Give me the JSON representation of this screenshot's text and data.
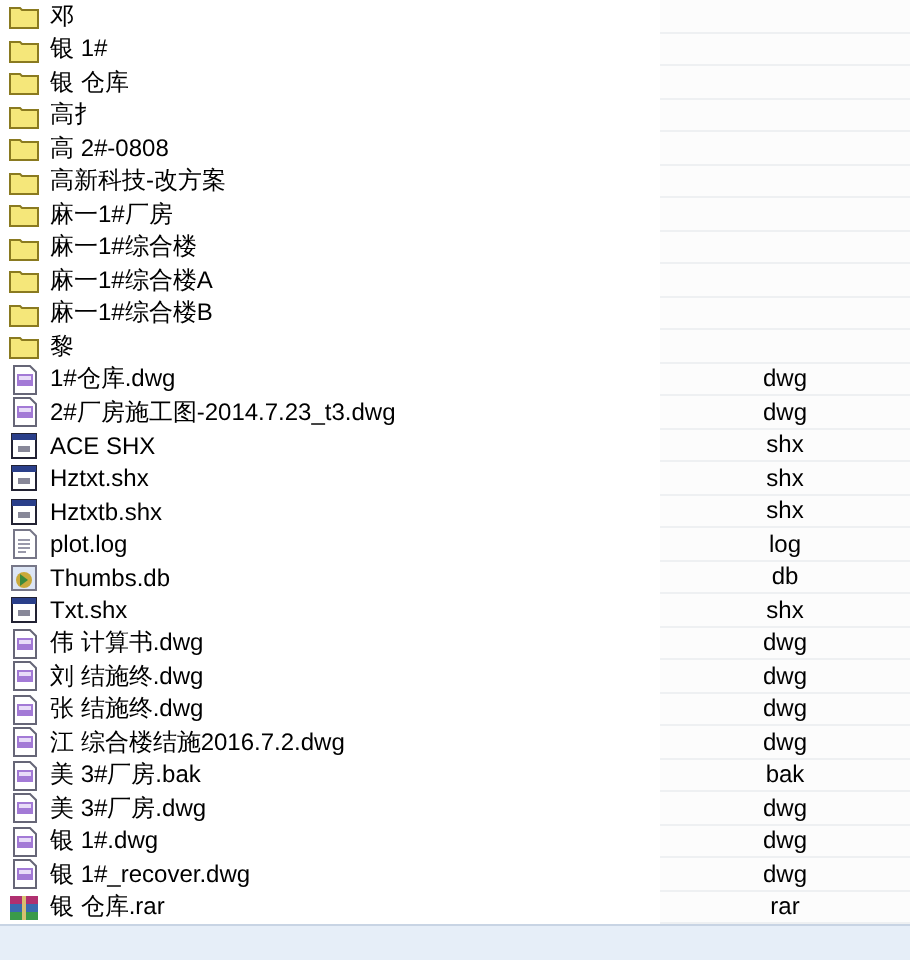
{
  "files": [
    {
      "name": "邓",
      "kind": "folder"
    },
    {
      "name": "银 1#",
      "kind": "folder"
    },
    {
      "name": "银 仓库",
      "kind": "folder"
    },
    {
      "name": "高扌",
      "kind": "folder"
    },
    {
      "name": "高 2#-0808",
      "kind": "folder"
    },
    {
      "name": "高新科技-改方案",
      "kind": "folder"
    },
    {
      "name": "麻一1#厂房",
      "kind": "folder"
    },
    {
      "name": "麻一1#综合楼",
      "kind": "folder"
    },
    {
      "name": "麻一1#综合楼A",
      "kind": "folder"
    },
    {
      "name": "麻一1#综合楼B",
      "kind": "folder"
    },
    {
      "name": "黎",
      "kind": "folder"
    },
    {
      "name": "1#仓库.dwg",
      "kind": "dwg",
      "type": "dwg"
    },
    {
      "name": "2#厂房施工图-2014.7.23_t3.dwg",
      "kind": "dwg",
      "type": "dwg"
    },
    {
      "name": "ACE SHX",
      "kind": "shx",
      "type": "shx"
    },
    {
      "name": "Hztxt.shx",
      "kind": "shx",
      "type": "shx"
    },
    {
      "name": "Hztxtb.shx",
      "kind": "shx",
      "type": "shx"
    },
    {
      "name": "plot.log",
      "kind": "log",
      "type": "log"
    },
    {
      "name": "Thumbs.db",
      "kind": "db",
      "type": "db"
    },
    {
      "name": "Txt.shx",
      "kind": "shx",
      "type": "shx"
    },
    {
      "name": "伟 计算书.dwg",
      "kind": "dwg",
      "type": "dwg"
    },
    {
      "name": "刘 结施终.dwg",
      "kind": "dwg",
      "type": "dwg"
    },
    {
      "name": "张 结施终.dwg",
      "kind": "dwg",
      "type": "dwg"
    },
    {
      "name": "江 综合楼结施2016.7.2.dwg",
      "kind": "dwg",
      "type": "dwg"
    },
    {
      "name": "美 3#厂房.bak",
      "kind": "dwg",
      "type": "bak"
    },
    {
      "name": "美 3#厂房.dwg",
      "kind": "dwg",
      "type": "dwg"
    },
    {
      "name": "银 1#.dwg",
      "kind": "dwg",
      "type": "dwg"
    },
    {
      "name": "银 1#_recover.dwg",
      "kind": "dwg",
      "type": "dwg"
    },
    {
      "name": "银 仓库.rar",
      "kind": "rar",
      "type": "rar"
    }
  ]
}
